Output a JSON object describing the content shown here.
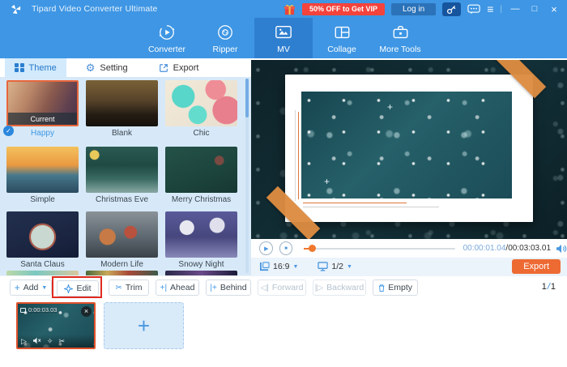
{
  "titlebar": {
    "title": "Tipard Video Converter Ultimate",
    "promo_badge": "50% OFF to Get VIP",
    "login_button": "Log in"
  },
  "nav": {
    "tabs": [
      {
        "label": "Converter",
        "active": false
      },
      {
        "label": "Ripper",
        "active": false
      },
      {
        "label": "MV",
        "active": true
      },
      {
        "label": "Collage",
        "active": false
      },
      {
        "label": "More Tools",
        "active": false
      }
    ]
  },
  "panel_tabs": [
    {
      "label": "Theme",
      "active": true
    },
    {
      "label": "Setting",
      "active": false
    },
    {
      "label": "Export",
      "active": false
    }
  ],
  "themes": [
    {
      "name": "Happy",
      "current": true,
      "badge": "Current"
    },
    {
      "name": "Blank"
    },
    {
      "name": "Chic"
    },
    {
      "name": "Simple"
    },
    {
      "name": "Christmas Eve"
    },
    {
      "name": "Merry Christmas"
    },
    {
      "name": "Santa Claus"
    },
    {
      "name": "Modern Life"
    },
    {
      "name": "Snowy Night"
    }
  ],
  "player": {
    "current_time": "00:00:01.04",
    "time_separator": "/",
    "total_time": "00:03:03.01",
    "aspect_ratio": "16:9",
    "display_mode": "1/2",
    "export_button": "Export"
  },
  "toolbar": {
    "add": "Add",
    "edit": "Edit",
    "trim": "Trim",
    "ahead": "Ahead",
    "behind": "Behind",
    "forward": "Forward",
    "backward": "Backward",
    "empty": "Empty",
    "page_current": "1",
    "page_separator": "/",
    "page_total": "1"
  },
  "timeline": {
    "clip_duration": "0:00:03.03"
  },
  "glyphs": {
    "menu": "≡",
    "separator": "|",
    "minimize": "—",
    "maximize": "□",
    "close": "×",
    "caret_down": "▼",
    "check": "✓",
    "plus": "+",
    "play": "▶",
    "stop": "■",
    "play_outline": "▷",
    "scissors": "✂",
    "gear": "⚙",
    "back_tri": "◁",
    "fwd_tri": "▷",
    "bar": "|",
    "star": "✧",
    "sparkle": "+"
  },
  "colors": {
    "accent_blue": "#3e96e4",
    "active_tab_blue": "#2f7fd0",
    "export_orange": "#ee6a33",
    "highlight_red": "#e02a1f",
    "promo_red": "#f4433c",
    "selected_border_orange": "#e8663c",
    "progress_orange": "#f0772c"
  }
}
